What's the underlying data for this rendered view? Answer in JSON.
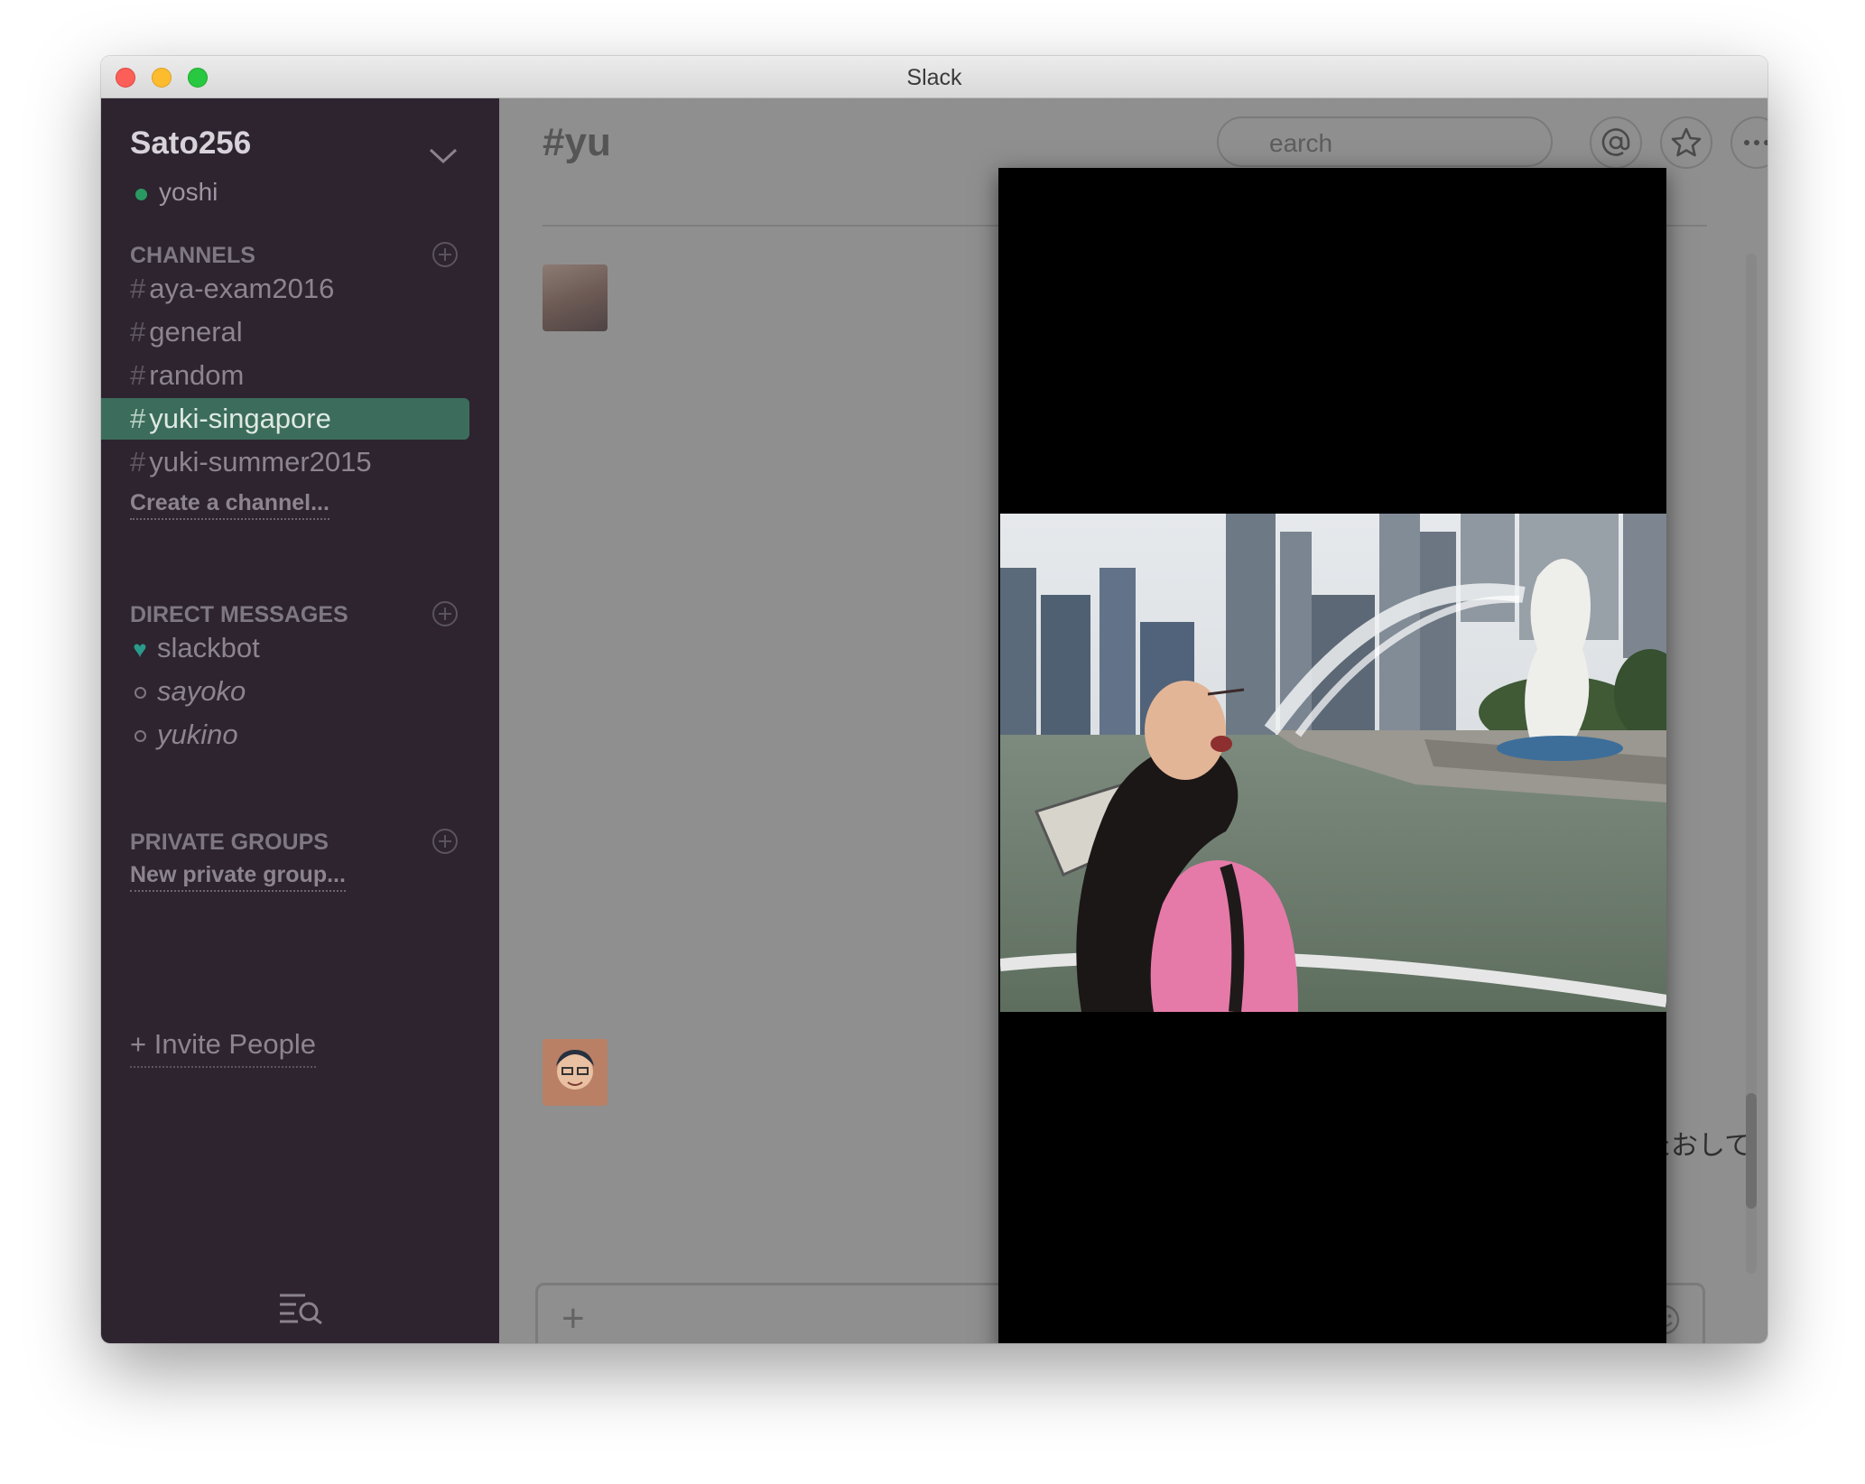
{
  "window": {
    "title": "Slack"
  },
  "sidebar": {
    "team_name": "Sato256",
    "user_name": "yoshi",
    "channels_title": "CHANNELS",
    "channels": [
      {
        "label": "aya-exam2016",
        "active": false
      },
      {
        "label": "general",
        "active": false
      },
      {
        "label": "random",
        "active": false
      },
      {
        "label": "yuki-singapore",
        "active": true
      },
      {
        "label": "yuki-summer2015",
        "active": false
      }
    ],
    "create_channel": "Create a channel...",
    "dm_title": "DIRECT MESSAGES",
    "direct_messages": [
      {
        "label": "slackbot",
        "status": "heart"
      },
      {
        "label": "sayoko",
        "status": "away"
      },
      {
        "label": "yukino",
        "status": "away"
      }
    ],
    "private_groups_title": "PRIVATE GROUPS",
    "new_private_group": "New private group...",
    "invite_people": "+ Invite People"
  },
  "header": {
    "channel_title_partial": "#yu",
    "search_placeholder_partial": "earch"
  },
  "messages": {
    "visible_text_partial": ")。定額制だから、使いたおして"
  },
  "composer": {
    "plus_label": "+"
  },
  "icons": {
    "team_menu": "chevron-down-icon",
    "add": "plus-circle-icon",
    "mentions": "at-sign-icon",
    "starred": "star-icon",
    "more": "ellipsis-icon",
    "quick_switcher": "list-search-icon",
    "emoji": "smiley-icon"
  },
  "colors": {
    "sidebar_bg": "#2d2430",
    "active_channel": "#3c6d5c",
    "presence_online": "#2a9961",
    "traffic_red": "#fc5f57",
    "traffic_yellow": "#fdbc2e",
    "traffic_green": "#28c840"
  }
}
